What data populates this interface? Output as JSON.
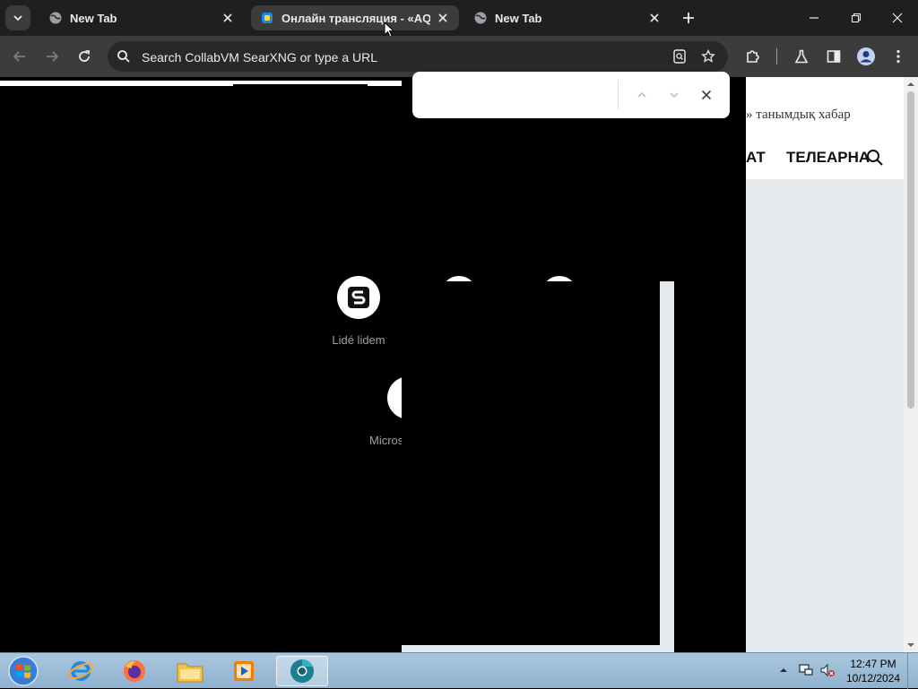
{
  "tabs": [
    {
      "title": "New Tab",
      "active": false
    },
    {
      "title": "Онлайн трансляция - «AQTÖBE»",
      "active": true
    },
    {
      "title": "New Tab",
      "active": false
    }
  ],
  "omnibox": {
    "placeholder": "Search CollabVM SearXNG or type a URL"
  },
  "page": {
    "subtitle": "» танымдық хабар",
    "menu_partial": "АТ",
    "menu_tv": "ТЕЛЕАРНА"
  },
  "shortcuts": [
    {
      "label": "Lidé lidem",
      "icon": "seznam-s-icon"
    },
    {
      "label": "Micros",
      "icon": "microsoft-icon"
    }
  ],
  "findbar": {
    "value": ""
  },
  "taskbar": {
    "time": "12:47 PM",
    "date": "10/12/2024"
  },
  "colors": {
    "tabstrip": "#1f1f1f",
    "toolbar": "#3c3c3c",
    "active_tab": "#3c3c3c",
    "omnibox": "#282828",
    "taskbar": "#9dbbd5"
  }
}
